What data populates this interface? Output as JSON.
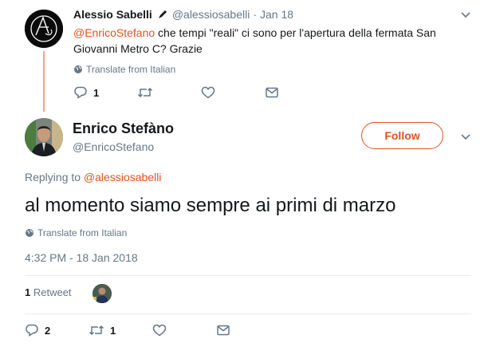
{
  "parent_tweet": {
    "name": "Alessio Sabelli",
    "handle": "@alessiosabelli",
    "separator": "·",
    "date": "Jan 18",
    "mention": "@EnricoStefano",
    "text": " che tempi \"reali\" ci sono per l'apertura della fermata San Giovanni Metro C? Grazie",
    "translate": "Translate from Italian",
    "reply_count": "1",
    "retweet_count": "",
    "like_count": ""
  },
  "main_tweet": {
    "name": "Enrico Stefàno",
    "handle": "@EnricoStefano",
    "follow_label": "Follow",
    "replying_prefix": "Replying to ",
    "replying_to": "@alessiosabelli",
    "text": "al momento siamo sempre ai primi di marzo",
    "translate": "Translate from Italian",
    "timestamp": "4:32 PM - 18 Jan 2018",
    "retweets_count": "1",
    "retweets_label": " Retweet",
    "reply_count": "2",
    "retweet_count": "1",
    "like_count": ""
  },
  "colors": {
    "accent": "#e0521e",
    "thread_line": "#f0a48a",
    "muted_text": "#657786",
    "divider": "#e6ecf0"
  },
  "icons": [
    "pen-icon",
    "caret-down-icon",
    "globe-icon",
    "reply-icon",
    "retweet-icon",
    "like-icon",
    "direct-message-icon"
  ]
}
